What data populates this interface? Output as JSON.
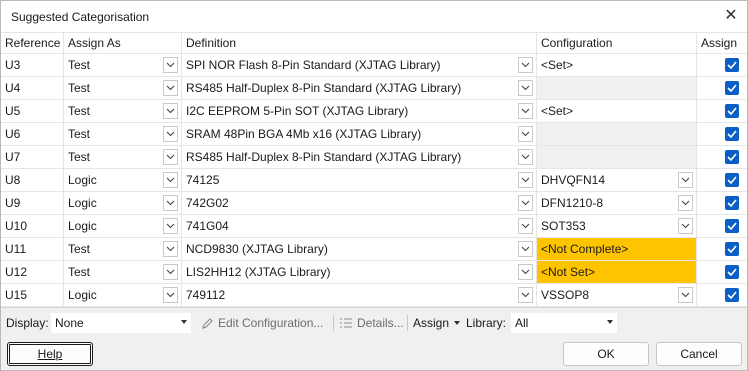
{
  "window": {
    "title": "Suggested Categorisation",
    "close_icon": "close-icon"
  },
  "columns": {
    "reference": "Reference",
    "assign_as": "Assign As",
    "definition": "Definition",
    "configuration": "Configuration",
    "assign": "Assign"
  },
  "rows": [
    {
      "ref": "U3",
      "assign_as": "Test",
      "definition": "SPI NOR Flash 8-Pin Standard (XJTAG Library)",
      "config": "<Set>",
      "config_style": "plain",
      "config_dropdown": false,
      "assigned": true
    },
    {
      "ref": "U4",
      "assign_as": "Test",
      "definition": "RS485 Half-Duplex 8-Pin Standard (XJTAG Library)",
      "config": "",
      "config_style": "gray",
      "config_dropdown": false,
      "assigned": true
    },
    {
      "ref": "U5",
      "assign_as": "Test",
      "definition": "I2C EEPROM 5-Pin SOT (XJTAG Library)",
      "config": "<Set>",
      "config_style": "plain",
      "config_dropdown": false,
      "assigned": true
    },
    {
      "ref": "U6",
      "assign_as": "Test",
      "definition": "SRAM 48Pin BGA 4Mb x16 (XJTAG Library)",
      "config": "",
      "config_style": "gray",
      "config_dropdown": false,
      "assigned": true
    },
    {
      "ref": "U7",
      "assign_as": "Test",
      "definition": "RS485 Half-Duplex 8-Pin Standard (XJTAG Library)",
      "config": "",
      "config_style": "gray",
      "config_dropdown": false,
      "assigned": true
    },
    {
      "ref": "U8",
      "assign_as": "Logic",
      "definition": "74125",
      "config": "DHVQFN14",
      "config_style": "plain",
      "config_dropdown": true,
      "assigned": true
    },
    {
      "ref": "U9",
      "assign_as": "Logic",
      "definition": "742G02",
      "config": "DFN1210-8",
      "config_style": "plain",
      "config_dropdown": true,
      "assigned": true
    },
    {
      "ref": "U10",
      "assign_as": "Logic",
      "definition": "741G04",
      "config": "SOT353",
      "config_style": "plain",
      "config_dropdown": true,
      "assigned": true
    },
    {
      "ref": "U11",
      "assign_as": "Test",
      "definition": "NCD9830 (XJTAG Library)",
      "config": "<Not Complete>",
      "config_style": "warn",
      "config_dropdown": false,
      "assigned": true
    },
    {
      "ref": "U12",
      "assign_as": "Test",
      "definition": "LIS2HH12 (XJTAG Library)",
      "config": "<Not Set>",
      "config_style": "warn",
      "config_dropdown": false,
      "assigned": true
    },
    {
      "ref": "U15",
      "assign_as": "Logic",
      "definition": "749112",
      "config": "VSSOP8",
      "config_style": "plain",
      "config_dropdown": true,
      "assigned": true
    }
  ],
  "toolbar": {
    "display_label": "Display:",
    "display_value": "None",
    "edit_configuration": "Edit Configuration...",
    "details": "Details...",
    "assign": "Assign",
    "library_label": "Library:",
    "library_value": "All"
  },
  "buttons": {
    "help": "Help",
    "ok": "OK",
    "cancel": "Cancel"
  },
  "colors": {
    "accent": "#0a5fc6",
    "warning": "#ffc400",
    "disabled_cell": "#f0f0f0"
  }
}
